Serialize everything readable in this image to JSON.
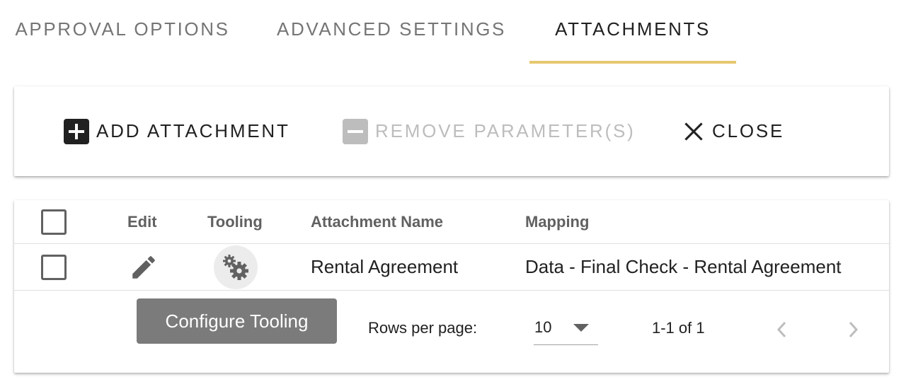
{
  "tabs": [
    {
      "label": "APPROVAL OPTIONS",
      "active": false
    },
    {
      "label": "ADVANCED SETTINGS",
      "active": false
    },
    {
      "label": "ATTACHMENTS",
      "active": true
    }
  ],
  "toolbar": {
    "add_label": "ADD ATTACHMENT",
    "remove_label": "REMOVE PARAMETER(S)",
    "close_label": "CLOSE"
  },
  "table": {
    "headers": {
      "edit": "Edit",
      "tooling": "Tooling",
      "name": "Attachment Name",
      "mapping": "Mapping"
    },
    "rows": [
      {
        "name": "Rental Agreement",
        "mapping": "Data - Final Check - Rental Agreement"
      }
    ]
  },
  "tooltip": {
    "text": "Configure Tooling"
  },
  "pagination": {
    "rows_per_page_label": "Rows per page:",
    "rows_per_page_value": "10",
    "range_text": "1-1 of 1"
  },
  "colors": {
    "accent": "#e6c86e",
    "icon": "#616161",
    "disabled": "#bdbdbd"
  }
}
